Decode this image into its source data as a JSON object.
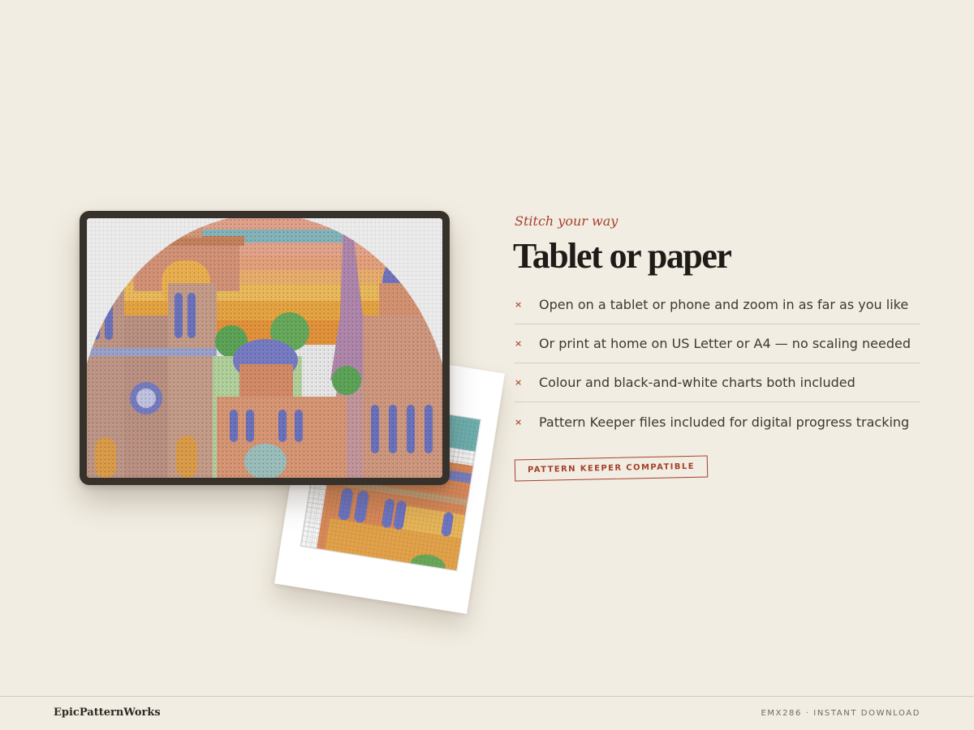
{
  "hero": {
    "kicker": "Stitch your way",
    "title": "Tablet or paper"
  },
  "features": [
    {
      "icon": "x-bullet-icon",
      "bullet": "×",
      "text": "Open on a tablet or phone and zoom in as far as you like"
    },
    {
      "icon": "x-bullet-icon",
      "bullet": "×",
      "text": "Or print at home on US Letter or A4 — no scaling needed"
    },
    {
      "icon": "x-bullet-icon",
      "bullet": "×",
      "text": "Colour and black-and-white charts both included"
    },
    {
      "icon": "x-bullet-icon",
      "bullet": "×",
      "text": "Pattern Keeper files included for digital progress tracking"
    }
  ],
  "badge": {
    "label": "PATTERN KEEPER COMPATIBLE"
  },
  "footer": {
    "brand": "EpicPatternWorks",
    "product_code": "EMX286 · INSTANT DOWNLOAD"
  },
  "colors": {
    "background": "#f2ede2",
    "accent": "#a3402c",
    "tablet_bezel": "#36312b",
    "heading": "#1f1b18"
  }
}
